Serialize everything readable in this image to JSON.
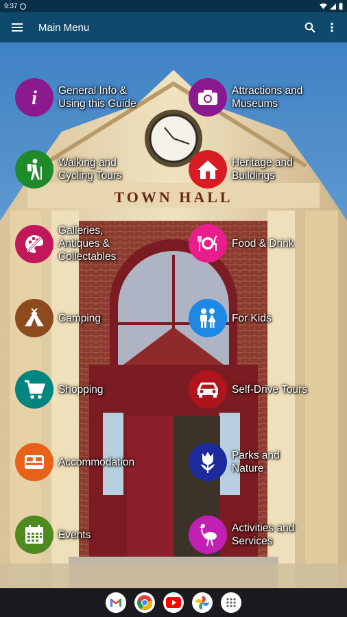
{
  "status_bar": {
    "time": "9:37"
  },
  "app_bar": {
    "title": "Main Menu",
    "menu_icon": "hamburger-icon",
    "search_icon": "search-icon",
    "overflow_icon": "more-vert-icon"
  },
  "menu": [
    {
      "label": "General Info &\nUsing this Guide",
      "color": "#8b1a8f",
      "icon": "info-icon"
    },
    {
      "label": "Attractions and\nMuseums",
      "color": "#8b1a8f",
      "icon": "camera-icon"
    },
    {
      "label": "Walking and\nCycling Tours",
      "color": "#1f8a2a",
      "icon": "hiker-icon"
    },
    {
      "label": "Heritage and\nBuildings",
      "color": "#d91c24",
      "icon": "house-icon"
    },
    {
      "label": "Galleries,\nAntiques &\nCollectables",
      "color": "#c2185b",
      "icon": "palette-icon"
    },
    {
      "label": "Food & Drink",
      "color": "#e91e8c",
      "icon": "plate-cutlery-icon"
    },
    {
      "label": "Camping",
      "color": "#8d4a1c",
      "icon": "tent-icon"
    },
    {
      "label": "For Kids",
      "color": "#1e88e5",
      "icon": "kids-icon"
    },
    {
      "label": "Shopping",
      "color": "#00857f",
      "icon": "cart-icon"
    },
    {
      "label": "Self-Drive Tours",
      "color": "#b0141c",
      "icon": "car-icon"
    },
    {
      "label": "Accommodation",
      "color": "#e8621a",
      "icon": "bed-icon"
    },
    {
      "label": "Parks and\nNature",
      "color": "#1c2a9e",
      "icon": "tulip-icon"
    },
    {
      "label": "Events",
      "color": "#4d8a1f",
      "icon": "calendar-icon"
    },
    {
      "label": "Activities and\nServices",
      "color": "#c21fb3",
      "icon": "emu-icon"
    }
  ],
  "nav_apps": [
    "gmail-icon",
    "chrome-icon",
    "youtube-icon",
    "photos-icon",
    "app-drawer-icon"
  ]
}
